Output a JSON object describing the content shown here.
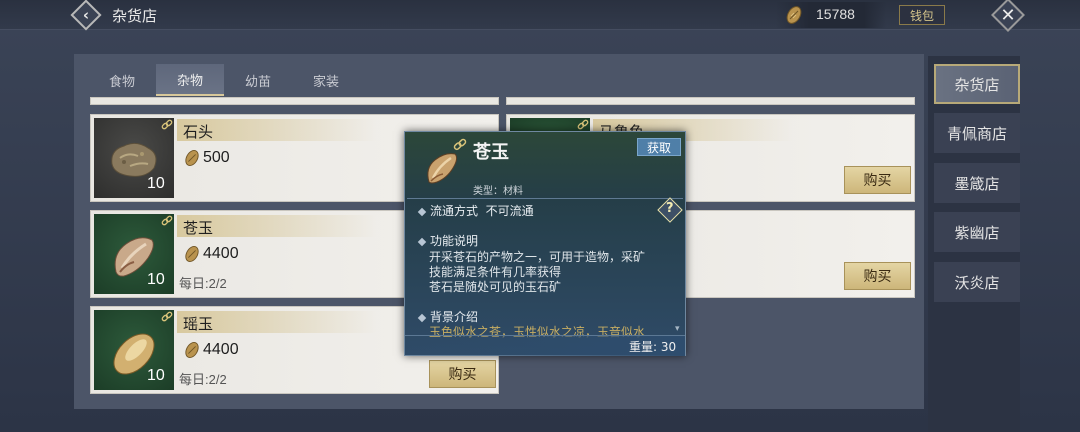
{
  "topbar": {
    "title": "杂货店",
    "currency_amount": "15788",
    "wallet_label": "钱包"
  },
  "tabs": [
    {
      "label": "食物",
      "active": false
    },
    {
      "label": "杂物",
      "active": true
    },
    {
      "label": "幼苗",
      "active": false
    },
    {
      "label": "家装",
      "active": false
    }
  ],
  "items": [
    {
      "name": "石头",
      "price": "500",
      "qty": "10",
      "daily": "",
      "buy_label": ""
    },
    {
      "name": "苍玉",
      "price": "4400",
      "qty": "10",
      "daily": "每日:2/2",
      "buy_label": "购买"
    },
    {
      "name": "瑶玉",
      "price": "4400",
      "qty": "10",
      "daily": "每日:2/2",
      "buy_label": "购买"
    },
    {
      "name": "马鲁鱼",
      "price": "",
      "qty": "",
      "daily": "",
      "buy_label": "购买"
    },
    {
      "name": "",
      "price": "",
      "qty": "",
      "daily": "",
      "buy_label": "购买"
    }
  ],
  "side_menu": [
    {
      "label": "杂货店",
      "active": true
    },
    {
      "label": "青佩商店",
      "active": false
    },
    {
      "label": "墨箴店",
      "active": false
    },
    {
      "label": "紫幽店",
      "active": false
    },
    {
      "label": "沃炎店",
      "active": false
    }
  ],
  "tooltip": {
    "name": "苍玉",
    "obtain_label": "获取",
    "type_text": "类型：材料",
    "circulation_label": "流通方式",
    "circulation_value": "不可流通",
    "function_title": "功能说明",
    "function_lines": [
      "开采苍石的产物之一，可用于造物，采矿",
      "技能满足条件有几率获得",
      "苍石是随处可见的玉石矿"
    ],
    "background_title": "背景介绍",
    "background_text": "玉色似水之苍，玉性似水之凉，玉音似水",
    "weight_text": "重量: 30"
  },
  "colors": {
    "accent_gold": "#d8c89a",
    "button_gold": "#cdb67a",
    "obtain_blue": "#4f7fa8",
    "tooltip_bg": "#2f4b68"
  },
  "icons": {
    "back": "chevron-left-icon",
    "close": "close-icon",
    "currency": "seed-icon",
    "link": "chain-link-icon",
    "help": "question-icon"
  }
}
